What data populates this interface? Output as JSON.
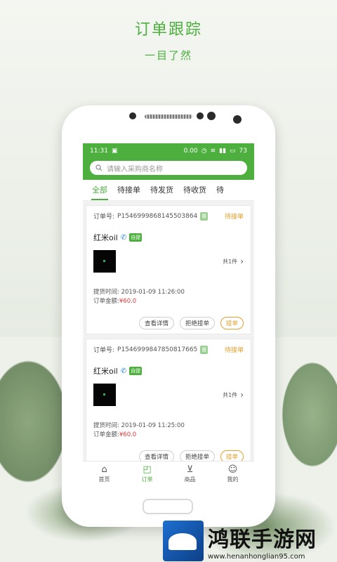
{
  "promo": {
    "title": "订单跟踪",
    "subtitle": "一目了然"
  },
  "statusbar": {
    "time": "11:31",
    "speed": "0.00",
    "battery": "73"
  },
  "search": {
    "placeholder": "请输入采购商名称"
  },
  "tabs": [
    {
      "label": "全部"
    },
    {
      "label": "待接单"
    },
    {
      "label": "待发货"
    },
    {
      "label": "待收货"
    },
    {
      "label": "待"
    }
  ],
  "orders": [
    {
      "order_label": "订单号:",
      "order_no": "P1546999868145503864",
      "badge": "普",
      "status": "待接单",
      "shop": "红米oil",
      "pickup_tag": "自提",
      "count": "共1件",
      "pickup_time_label": "提货时间:",
      "pickup_time": "2019-01-09 11:26:00",
      "amount_label": "订单金额:",
      "amount": "¥60.0",
      "btn_detail": "查看详情",
      "btn_reject": "拒绝接单",
      "btn_accept": "接单"
    },
    {
      "order_label": "订单号:",
      "order_no": "P1546999847850817665",
      "badge": "普",
      "status": "待接单",
      "shop": "红米oil",
      "pickup_tag": "自提",
      "count": "共1件",
      "pickup_time_label": "提货时间:",
      "pickup_time": "2019-01-09 11:25:00",
      "amount_label": "订单金额:",
      "amount": "¥60.0",
      "btn_detail": "查看详情",
      "btn_reject": "拒绝接单",
      "btn_accept": "接单"
    }
  ],
  "bottomnav": [
    {
      "label": "首页",
      "icon": "home-icon"
    },
    {
      "label": "订单",
      "icon": "order-bag-icon"
    },
    {
      "label": "商品",
      "icon": "cart-icon"
    },
    {
      "label": "我的",
      "icon": "user-icon"
    }
  ],
  "watermark": {
    "name": "鸿联手游网",
    "url": "www.henanhonglian95.com"
  },
  "colors": {
    "brand": "#4caf3e",
    "status": "#e2a02d",
    "price": "#e0393b"
  }
}
